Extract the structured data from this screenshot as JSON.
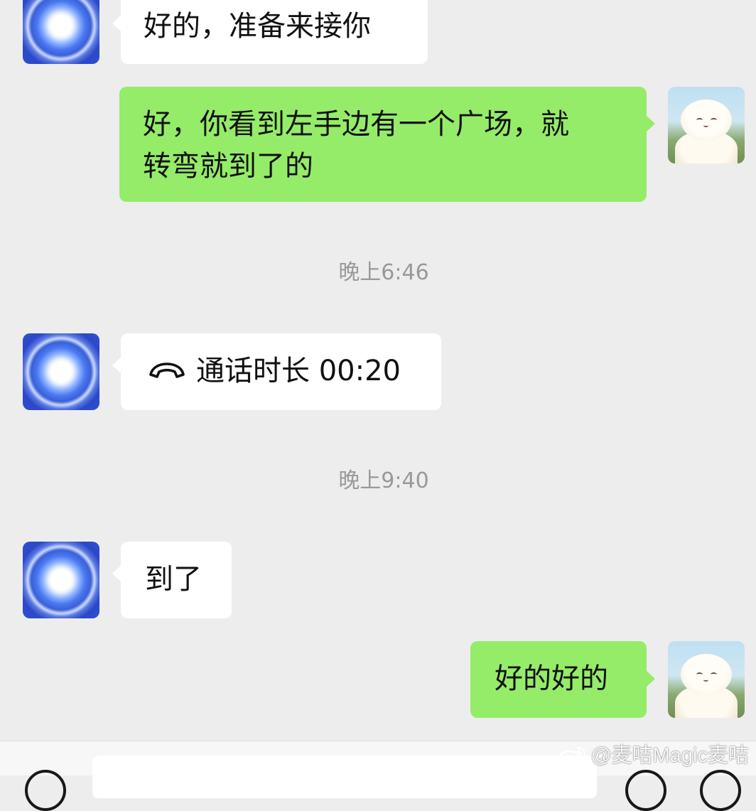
{
  "messages": [
    {
      "side": "left",
      "text": "好的，准备来接你"
    },
    {
      "side": "right",
      "text_line1": "好，你看到左手边有一个广场，就",
      "text_line2": "转弯就到了的"
    },
    {
      "side": "left",
      "text": "到了"
    },
    {
      "side": "right",
      "text": "好的好的"
    }
  ],
  "timestamps": [
    "晚上6:46",
    "晚上9:40"
  ],
  "call": {
    "label": "通话时长 00:20",
    "icon": "phone-hangup-icon"
  },
  "watermark": {
    "text": "@麦咭Magic麦咭",
    "icon": "weibo-logo-icon"
  },
  "colors": {
    "background": "#ededed",
    "incoming_bubble": "#ffffff",
    "outgoing_bubble": "#95ec69",
    "timestamp_text": "#999999"
  }
}
